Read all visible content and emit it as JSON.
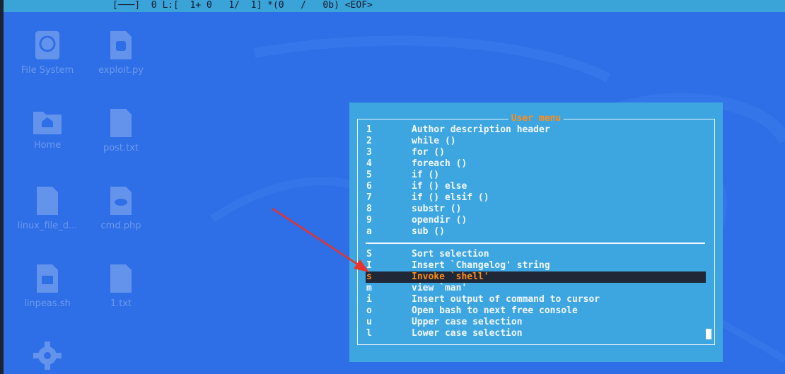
{
  "statusbar": {
    "text": "[───]  0 L:[  1+ 0   1/  1] *(0   /   0b) <EOF>"
  },
  "desktop": {
    "icons": [
      {
        "label": "File System",
        "icon": "hard-drive-icon"
      },
      {
        "label": "exploit.py",
        "icon": "python-file-icon"
      },
      {
        "label": "Home",
        "icon": "home-folder-icon"
      },
      {
        "label": "post.txt",
        "icon": "text-file-icon"
      },
      {
        "label": "linux_file_d...",
        "icon": "text-file-icon"
      },
      {
        "label": "cmd.php",
        "icon": "php-file-icon"
      },
      {
        "label": "linpeas.sh",
        "icon": "script-file-icon"
      },
      {
        "label": "1.txt",
        "icon": "text-file-icon"
      },
      {
        "label": "",
        "icon": "gear-icon"
      }
    ]
  },
  "menu": {
    "title": "User menu",
    "items_top": [
      {
        "key": "1",
        "label": "Author description header"
      },
      {
        "key": "2",
        "label": "while ()"
      },
      {
        "key": "3",
        "label": "for ()"
      },
      {
        "key": "4",
        "label": "foreach ()"
      },
      {
        "key": "5",
        "label": "if ()"
      },
      {
        "key": "6",
        "label": "if () else"
      },
      {
        "key": "7",
        "label": "if () elsif ()"
      },
      {
        "key": "8",
        "label": "substr ()"
      },
      {
        "key": "9",
        "label": "opendir ()"
      },
      {
        "key": "a",
        "label": "sub ()"
      }
    ],
    "items_bottom": [
      {
        "key": "S",
        "label": "Sort selection"
      },
      {
        "key": "I",
        "label": "Insert `Changelog' string"
      },
      {
        "key": "s",
        "label": "Invoke `shell'",
        "selected": true
      },
      {
        "key": "m",
        "label": "view `man'"
      },
      {
        "key": "i",
        "label": "Insert output of command to cursor"
      },
      {
        "key": "o",
        "label": "Open bash to next free console"
      },
      {
        "key": "u",
        "label": "Upper case selection"
      },
      {
        "key": "l",
        "label": "Lower case selection"
      }
    ],
    "colors": {
      "dialog_bg": "#3da6e0",
      "title": "#ff8c1a",
      "selected_bg": "#202838",
      "selected_fg": "#ff8c1a",
      "arrow": "#e8322b"
    }
  }
}
